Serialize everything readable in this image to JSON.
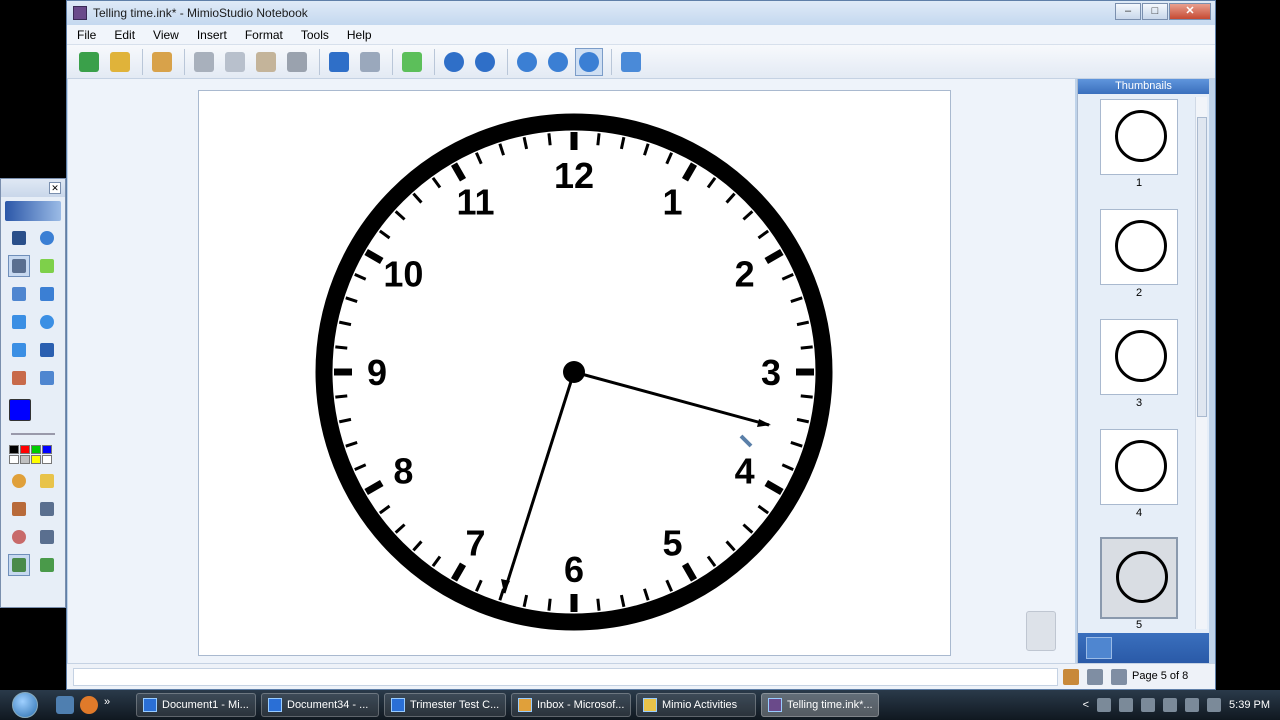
{
  "window": {
    "title": "Telling time.ink* - MimioStudio Notebook"
  },
  "menu": [
    "File",
    "Edit",
    "View",
    "Insert",
    "Format",
    "Tools",
    "Help"
  ],
  "toolbar_icons": [
    "open-icon",
    "save-icon",
    "print-icon",
    "cut-icon",
    "copy-icon",
    "paste-icon",
    "delete-icon",
    "undo-icon",
    "redo-icon",
    "add-page-icon",
    "prev-page-icon",
    "next-page-icon",
    "zoom-in-icon",
    "zoom-out-icon",
    "zoom-fit-icon",
    "window-icon"
  ],
  "clock": {
    "numbers": [
      "12",
      "1",
      "2",
      "3",
      "4",
      "5",
      "6",
      "7",
      "8",
      "9",
      "10",
      "11"
    ]
  },
  "toolbox_icons": [
    "select-icon",
    "zoom-icon",
    "pen-icon",
    "highlighter-icon",
    "eraser-icon",
    "line-icon",
    "rectangle-icon",
    "ellipse-icon",
    "triangle-icon",
    "text-icon",
    "image-icon",
    "capture-icon",
    "color-icon",
    "palette-icon",
    "fill-icon",
    "folder-icon",
    "gallery-icon",
    "reveal-icon",
    "spotlight-icon",
    "record-icon",
    "tools-icon",
    "export-icon"
  ],
  "palette_colors": [
    "#000000",
    "#ff0000",
    "#00c000",
    "#0000ff",
    "#ffffff",
    "#c0c0c0",
    "#ffff00",
    "#ffffff"
  ],
  "thumbnails": {
    "header": "Thumbnails",
    "pages": [
      "1",
      "2",
      "3",
      "4",
      "5"
    ]
  },
  "status": {
    "page": "Page 5 of 8"
  },
  "taskbar": {
    "items": [
      "Document1 - Mi...",
      "Document34 - ...",
      "Trimester Test C...",
      "Inbox - Microsof...",
      "Mimio Activities",
      "Telling time.ink*..."
    ],
    "time": "5:39 PM"
  }
}
